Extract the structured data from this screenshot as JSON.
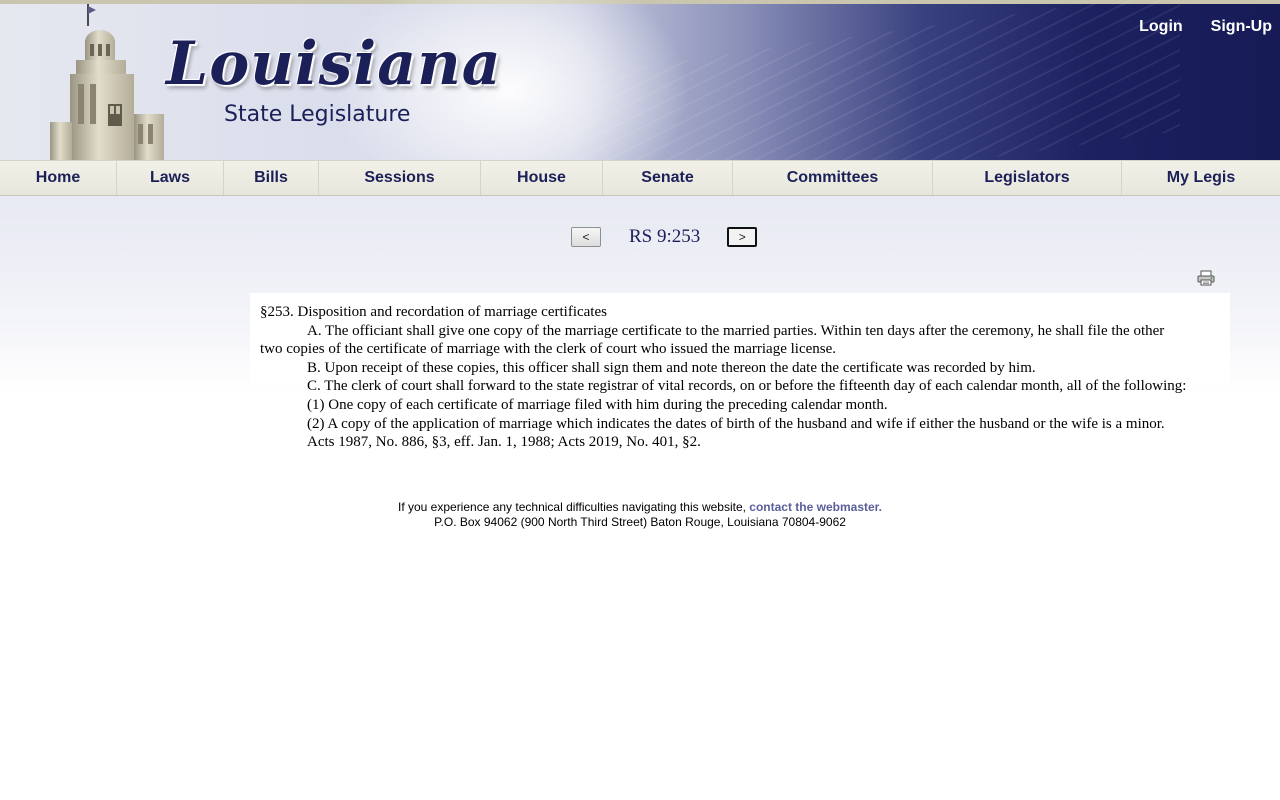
{
  "header": {
    "logo_title": "Louisiana",
    "logo_subtitle": "State Legislature",
    "login_label": "Login",
    "signup_label": "Sign-Up"
  },
  "nav": {
    "items": [
      {
        "label": "Home"
      },
      {
        "label": "Laws"
      },
      {
        "label": "Bills"
      },
      {
        "label": "Sessions"
      },
      {
        "label": "House"
      },
      {
        "label": "Senate"
      },
      {
        "label": "Committees"
      },
      {
        "label": "Legislators"
      },
      {
        "label": "My Legis"
      }
    ]
  },
  "pager": {
    "prev_label": "<",
    "title": "RS 9:253",
    "next_label": ">"
  },
  "toolbar": {
    "print_icon": "printer-icon"
  },
  "document": {
    "heading": "§253. Disposition and recordation of marriage certificates",
    "paragraphs": [
      "A. The officiant shall give one copy of the marriage certificate to the married parties. Within ten days after the ceremony, he shall file the other two copies of the certificate of marriage with the clerk of court who issued the marriage license.",
      "B. Upon receipt of these copies, this officer shall sign them and note thereon the date the certificate was recorded by him.",
      "C. The clerk of court shall forward to the state registrar of vital records, on or before the fifteenth day of each calendar month, all of the following:",
      "(1) One copy of each certificate of marriage filed with him during the preceding calendar month.",
      "(2) A copy of the application of marriage which indicates the dates of birth of the husband and wife if either the husband or the wife is a minor.",
      "Acts 1987, No. 886, §3, eff. Jan. 1, 1988; Acts 2019, No. 401, §2."
    ]
  },
  "footer": {
    "line1_text": "If you experience any technical difficulties navigating this website, ",
    "line1_link": "contact the webmaster.",
    "line2": "P.O. Box 94062 (900 North Third Street) Baton Rouge, Louisiana 70804-9062"
  },
  "colors": {
    "brand_navy": "#1c2058",
    "link_purple": "#5a5f9a"
  }
}
